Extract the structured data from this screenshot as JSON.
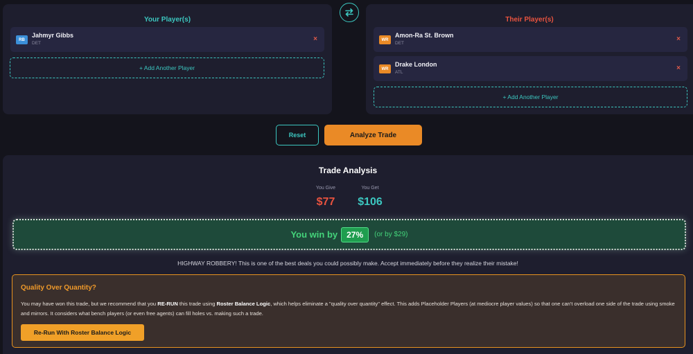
{
  "your_panel": {
    "title": "Your Player(s)",
    "title_color": "#3cc7c0",
    "players": [
      {
        "position": "RB",
        "name": "Jahmyr Gibbs",
        "team": "DET",
        "badge_color": "#3b8fd9",
        "remove": "×"
      }
    ],
    "add_label": "+ Add Another Player"
  },
  "their_panel": {
    "title": "Their Player(s)",
    "title_color": "#e8533f",
    "players": [
      {
        "position": "WR",
        "name": "Amon-Ra St. Brown",
        "team": "DET",
        "badge_color": "#ea8a26",
        "remove": "×"
      },
      {
        "position": "WR",
        "name": "Drake London",
        "team": "ATL",
        "badge_color": "#ea8a26",
        "remove": "×"
      }
    ],
    "add_label": "+ Add Another Player"
  },
  "swap": {
    "icon": "swap-arrows-icon"
  },
  "actions": {
    "reset_label": "Reset",
    "analyze_label": "Analyze Trade"
  },
  "analysis": {
    "title": "Trade Analysis",
    "give_label": "You Give",
    "give_value": "$77",
    "give_color": "#e8533f",
    "get_label": "You Get",
    "get_value": "$106",
    "get_color": "#3cc7c0",
    "win_text": "You win by",
    "win_pct": "27%",
    "win_alt": "(or by $29)",
    "verdict": "HIGHWAY ROBBERY! This is one of the best deals you could possibly make. Accept immediately before they realize their mistake!"
  },
  "quality": {
    "title": "Quality Over Quantity?",
    "body_1": "You may have won this trade, but we recommend that you ",
    "body_rerun": "RE-RUN",
    "body_2": " this trade using ",
    "body_logic": "Roster Balance Logic",
    "body_3": ", which helps eliminate a \"quality over quantity\" effect. This adds Placeholder Players (at mediocre player values) so that one can't overload one side of the trade using smoke and mirrors. It considers what bench players (or even free agents) can fill holes vs. making such a trade.",
    "button_label": "Re-Run With Roster Balance Logic"
  }
}
